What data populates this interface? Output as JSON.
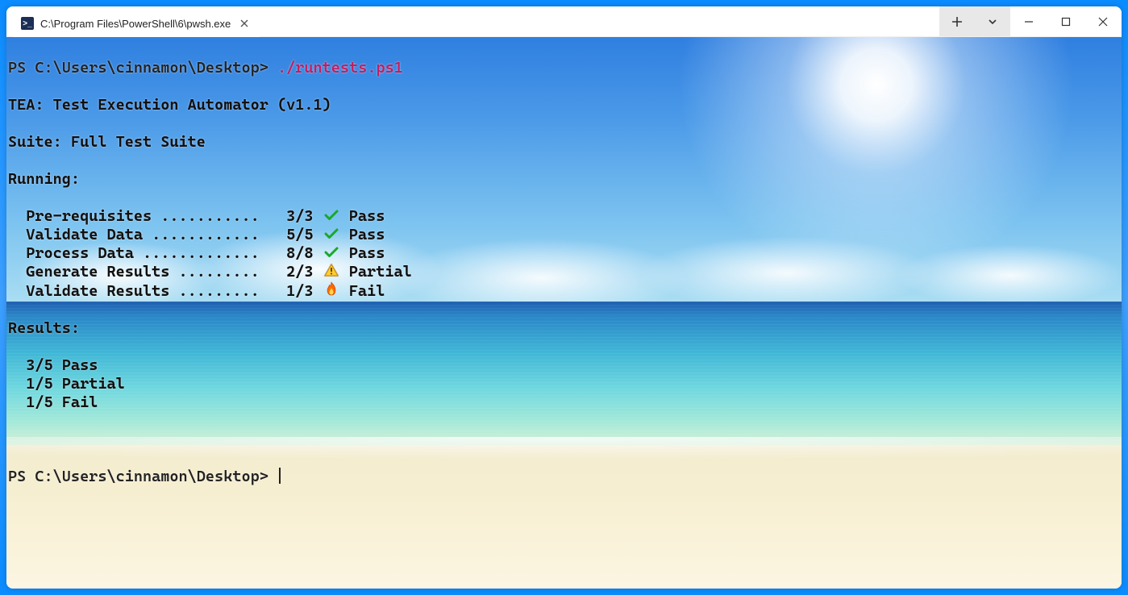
{
  "window": {
    "tab_title": "C:\\Program Files\\PowerShell\\6\\pwsh.exe"
  },
  "terminal": {
    "prompt": "PS C:\\Users\\cinnamon\\Desktop>",
    "command": "./runtests.ps1",
    "header_line": "TEA: Test Execution Automator (v1.1)",
    "suite_line": "Suite: Full Test Suite",
    "running_label": "Running:",
    "tests": [
      {
        "name": "Pre-requisites",
        "dots": "...........",
        "score": "3/3",
        "icon": "check",
        "status": "Pass"
      },
      {
        "name": "Validate Data",
        "dots": "............",
        "score": "5/5",
        "icon": "check",
        "status": "Pass"
      },
      {
        "name": "Process Data",
        "dots": ".............",
        "score": "8/8",
        "icon": "check",
        "status": "Pass"
      },
      {
        "name": "Generate Results",
        "dots": ".........",
        "score": "2/3",
        "icon": "warn",
        "status": "Partial"
      },
      {
        "name": "Validate Results",
        "dots": ".........",
        "score": "1/3",
        "icon": "fail",
        "status": "Fail"
      }
    ],
    "results_label": "Results:",
    "results": [
      "3/5 Pass",
      "1/5 Partial",
      "1/5 Fail"
    ],
    "prompt2": "PS C:\\Users\\cinnamon\\Desktop>"
  }
}
